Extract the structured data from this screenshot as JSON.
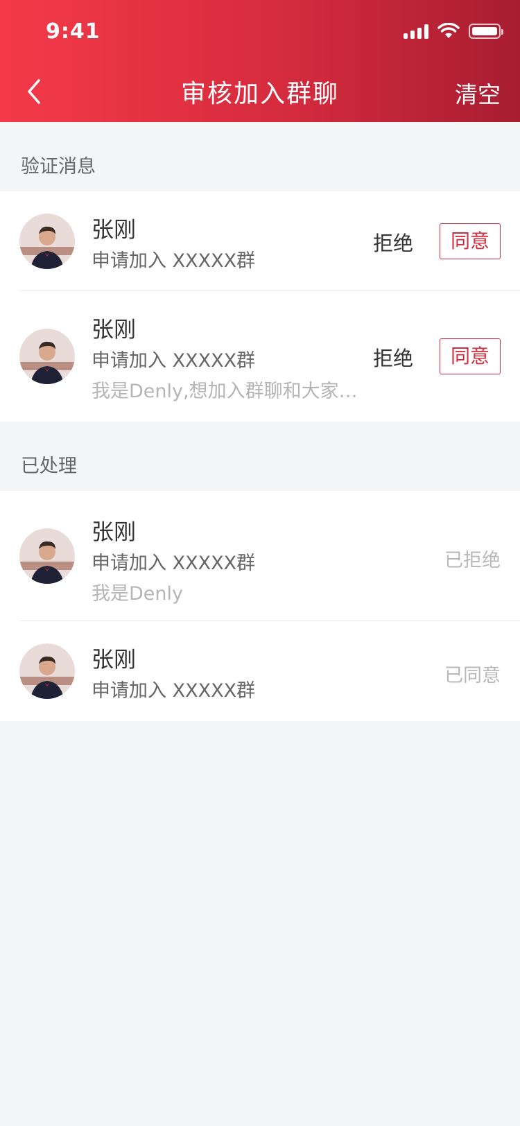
{
  "status_bar": {
    "time": "9:41"
  },
  "nav": {
    "title": "审核加入群聊",
    "clear_label": "清空"
  },
  "sections": {
    "pending_title": "验证消息",
    "processed_title": "已处理"
  },
  "pending": [
    {
      "name": "张刚",
      "apply": "申请加入 XXXXX群",
      "message": "",
      "reject_label": "拒绝",
      "agree_label": "同意"
    },
    {
      "name": "张刚",
      "apply": "申请加入 XXXXX群",
      "message": "我是Denly,想加入群聊和大家…",
      "reject_label": "拒绝",
      "agree_label": "同意"
    }
  ],
  "processed": [
    {
      "name": "张刚",
      "apply": "申请加入 XXXXX群",
      "message": "我是Denly",
      "status": "已拒绝"
    },
    {
      "name": "张刚",
      "apply": "申请加入 XXXXX群",
      "message": "",
      "status": "已同意"
    }
  ],
  "colors": {
    "header_start": "#f43a49",
    "header_end": "#a81d31",
    "accent": "#d22c3d"
  },
  "icons": {
    "back": "chevron-left-icon",
    "signal": "cellular-signal-icon",
    "wifi": "wifi-icon",
    "battery": "battery-icon"
  }
}
